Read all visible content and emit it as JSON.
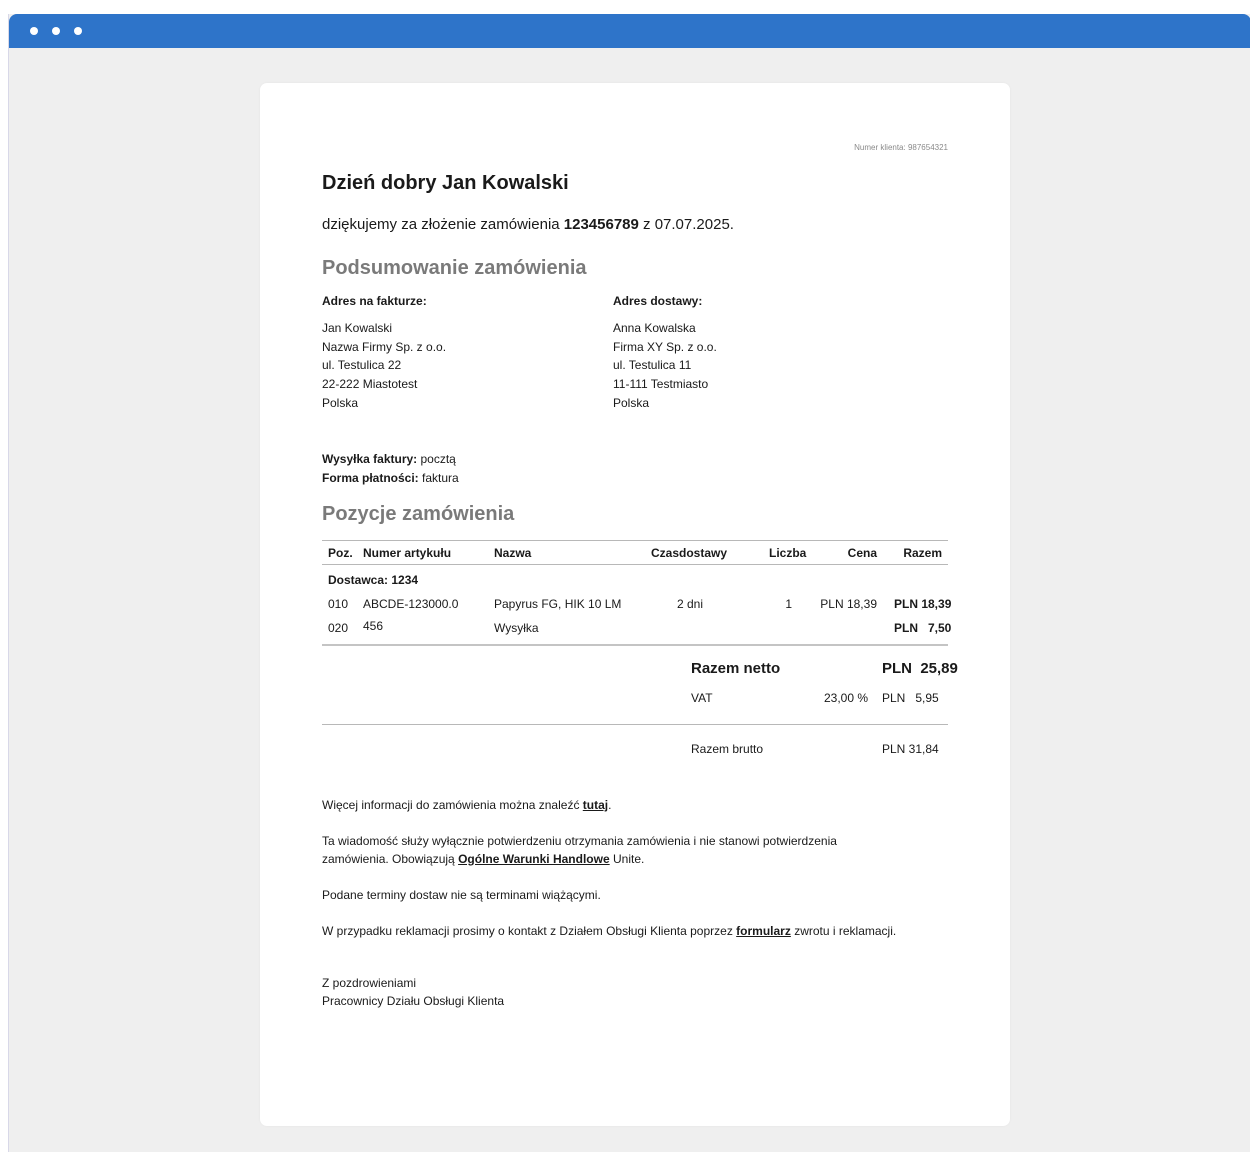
{
  "customer_number": "Numer klienta: 987654321",
  "greeting": "Dzień dobry Jan Kowalski",
  "thanks": {
    "prefix": "dziękujemy za złożenie zamówienia ",
    "order_no": "123456789",
    "suffix": " z 07.07.2025."
  },
  "summary_heading": "Podsumowanie zamówienia",
  "billing": {
    "label": "Adres na fakturze:",
    "lines": [
      "Jan Kowalski",
      "Nazwa Firmy Sp. z o.o.",
      "ul. Testulica 22",
      "22-222 Miastotest",
      "Polska"
    ]
  },
  "shipping": {
    "label": "Adres dostawy:",
    "lines": [
      "Anna Kowalska",
      "Firma XY Sp. z o.o.",
      "ul. Testulica 11",
      "11-111 Testmiasto",
      "Polska"
    ]
  },
  "invoice_delivery": {
    "label": "Wysyłka faktury:",
    "value": " pocztą"
  },
  "payment_method": {
    "label": "Forma płatności:",
    "value": " faktura"
  },
  "items_heading": "Pozycje zamówienia",
  "table": {
    "headers": {
      "pos": "Poz.",
      "article": "Numer artykułu",
      "name": "Nazwa",
      "delivery": "Czasdostawy",
      "qty": "Liczba",
      "price": "Cena",
      "total": "Razem"
    },
    "supplier": "Dostawca: 1234",
    "rows": [
      {
        "pos": "010",
        "article": "ABCDE-123000.0",
        "name": "Papyrus FG, HIK 10 LM",
        "delivery": "2 dni",
        "qty": "1",
        "price": "PLN 18,39",
        "total": "PLN 18,39"
      },
      {
        "pos": "020",
        "article": "456",
        "name": "Wysyłka",
        "delivery": "",
        "qty": "",
        "price": "",
        "total": "PLN   7,50"
      }
    ]
  },
  "totals": {
    "net_label": "Razem netto",
    "net_value": "PLN  25,89",
    "vat_label": "VAT",
    "vat_rate": "23,00 %",
    "vat_value": "PLN   5,95",
    "gross_label": "Razem brutto",
    "gross_value": "PLN 31,84"
  },
  "footer": {
    "more_info_prefix": "Więcej informacji do zamówienia można znaleźć ",
    "more_info_link": "tutaj",
    "more_info_suffix": ".",
    "confirmation_text": "Ta wiadomość służy wyłącznie potwierdzeniu otrzymania zamówienia i nie stanowi potwierdzenia zamówienia. Obowiązują ",
    "terms_link": "Ogólne Warunki Handlowe",
    "terms_suffix": " Unite.",
    "delivery_terms": "Podane terminy dostaw nie są terminami wiążącymi.",
    "complaint_prefix": "W przypadku reklamacji prosimy o kontakt z Działem Obsługi Klienta poprzez ",
    "complaint_link": "formularz",
    "complaint_suffix": " zwrotu i reklamacji.",
    "regards": "Z pozdrowieniami",
    "signature": "Pracownicy Działu Obsługi Klienta"
  }
}
